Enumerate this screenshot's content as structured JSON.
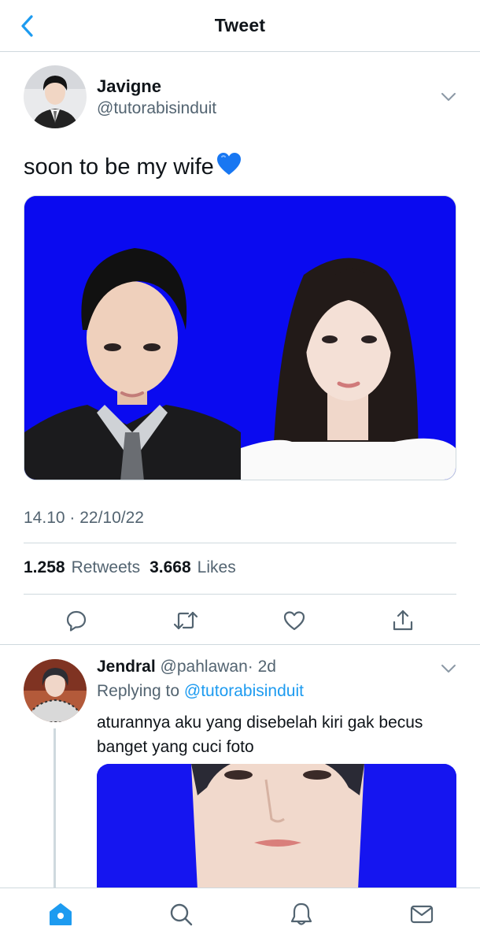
{
  "header": {
    "title": "Tweet"
  },
  "tweet": {
    "author_name": "Javigne",
    "author_handle": "@tutorabisinduit",
    "text": "soon to be my wife",
    "emoji": "💙",
    "timestamp": "14.10 · 22/10/22",
    "retweets_count": "1.258",
    "retweets_label": "Retweets",
    "likes_count": "3.668",
    "likes_label": "Likes"
  },
  "reply": {
    "author_name": "Jendral",
    "author_handle": "@pahlawan",
    "time": "· 2d",
    "replying_prefix": "Replying to",
    "replying_to": "@tutorabisinduit",
    "text": "aturannya aku yang disebelah kiri gak becus banget yang cuci foto"
  },
  "colors": {
    "accent": "#1d9bf0",
    "media_background": "#0a0af0",
    "text_secondary": "#536471"
  },
  "icons": {
    "back": "chevron-left-icon",
    "more": "chevron-down-icon",
    "reply": "reply-icon",
    "retweet": "retweet-icon",
    "like": "heart-icon",
    "share": "share-icon",
    "tab_home": "home-icon",
    "tab_search": "search-icon",
    "tab_notifications": "bell-icon",
    "tab_messages": "mail-icon"
  }
}
